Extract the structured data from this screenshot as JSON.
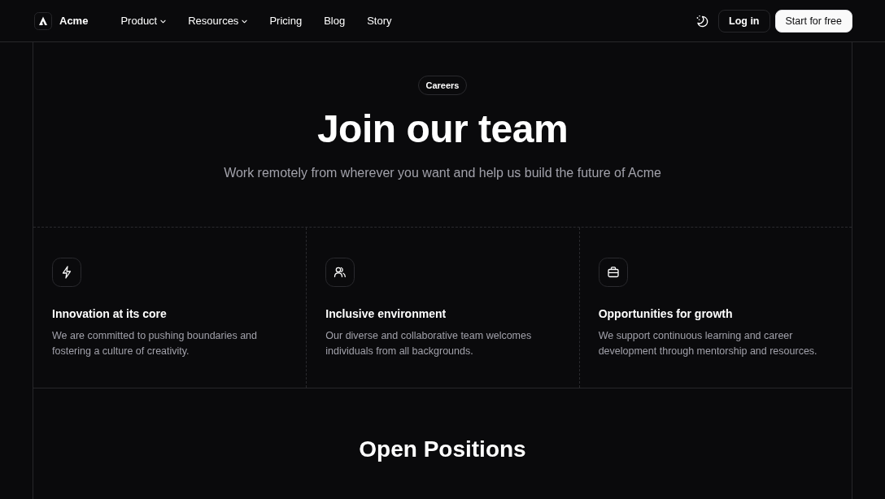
{
  "header": {
    "brand": "Acme",
    "nav": [
      {
        "label": "Product",
        "kind": "menu"
      },
      {
        "label": "Resources",
        "kind": "menu"
      },
      {
        "label": "Pricing",
        "kind": "link"
      },
      {
        "label": "Blog",
        "kind": "link"
      },
      {
        "label": "Story",
        "kind": "link"
      }
    ],
    "login": "Log in",
    "cta": "Start for free"
  },
  "hero": {
    "badge": "Careers",
    "title": "Join our team",
    "subtitle": "Work remotely from wherever you want and help us build the future of Acme"
  },
  "features": [
    {
      "title": "Innovation at its core",
      "text": "We are committed to pushing boundaries and fostering a culture of creativity."
    },
    {
      "title": "Inclusive environment",
      "text": "Our diverse and collaborative team welcomes individuals from all backgrounds."
    },
    {
      "title": "Opportunities for growth",
      "text": "We support continuous learning and career development through mentorship and resources."
    }
  ],
  "positions": {
    "title": "Open Positions"
  }
}
